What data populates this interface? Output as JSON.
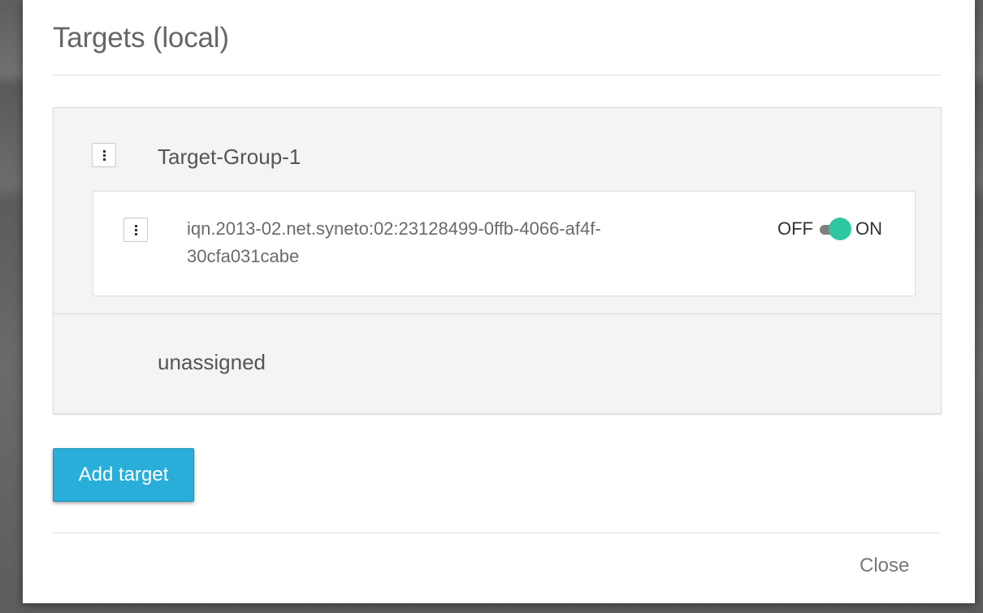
{
  "dialog": {
    "title": "Targets (local)",
    "groups": [
      {
        "name": "Target-Group-1",
        "targets": [
          {
            "iqn_line1": "iqn.2013-02.net.syneto:02:23128499-0ffb-4066-af4f-",
            "iqn_line2": "30cfa031cabe",
            "toggle_off_label": "OFF",
            "toggle_on_label": "ON",
            "enabled": true
          }
        ]
      }
    ],
    "unassigned_label": "unassigned",
    "add_target_label": "Add target",
    "close_label": "Close"
  },
  "icons": {
    "group_menu": "kebab-menu-icon",
    "target_menu": "kebab-menu-icon"
  },
  "colors": {
    "accent": "#29aed9",
    "toggle_on": "#2fc7a1",
    "panel_bg": "#f4f4f4"
  }
}
